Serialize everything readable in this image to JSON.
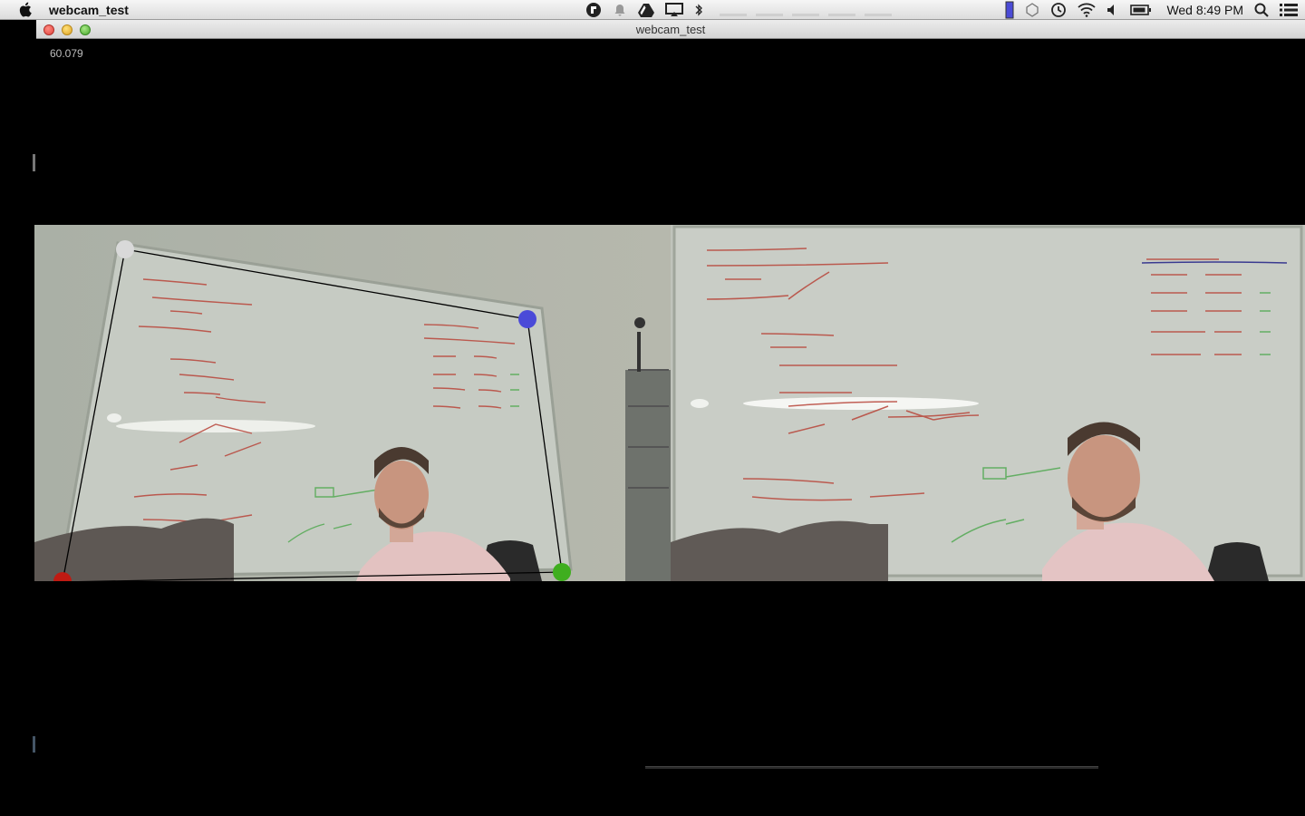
{
  "menubar": {
    "app_name": "webcam_test",
    "clock": "Wed 8:49 PM",
    "icons": [
      "apple-icon",
      "evernote-icon",
      "notifications-icon",
      "drive-icon",
      "airplay-icon",
      "bluetooth-icon",
      "battery-gauge-icon",
      "time-machine-icon",
      "wifi-icon",
      "volume-icon",
      "battery-icon",
      "spotlight-icon",
      "notification-center-icon"
    ]
  },
  "window": {
    "title": "webcam_test"
  },
  "overlay": {
    "fps": "60.079"
  },
  "calibration": {
    "handle_colors": {
      "top_left": "#d9d9d9",
      "top_right": "#4a4ad8",
      "bottom_right": "#3fae1f",
      "bottom_left": "#c01a12"
    }
  },
  "whiteboard_text": {
    "steps": [
      "1. Boot to cdz",
      "2. if mirror write to L4 OK fail reboot",
      "3. Boot to default"
    ],
    "table_headers": [
      "Milestone",
      "Date",
      "Days left"
    ],
    "table_rows": [
      [
        "FC",
        "8-1",
        "—"
      ],
      [
        "CP5",
        "9-5",
        "—"
      ],
      [
        "CF",
        "10-3",
        "8"
      ],
      [
        "Stringfreeze",
        "10-17",
        "18"
      ],
      [
        "Release",
        "11-14",
        "38"
      ]
    ],
    "heading": "Boot Chain"
  }
}
